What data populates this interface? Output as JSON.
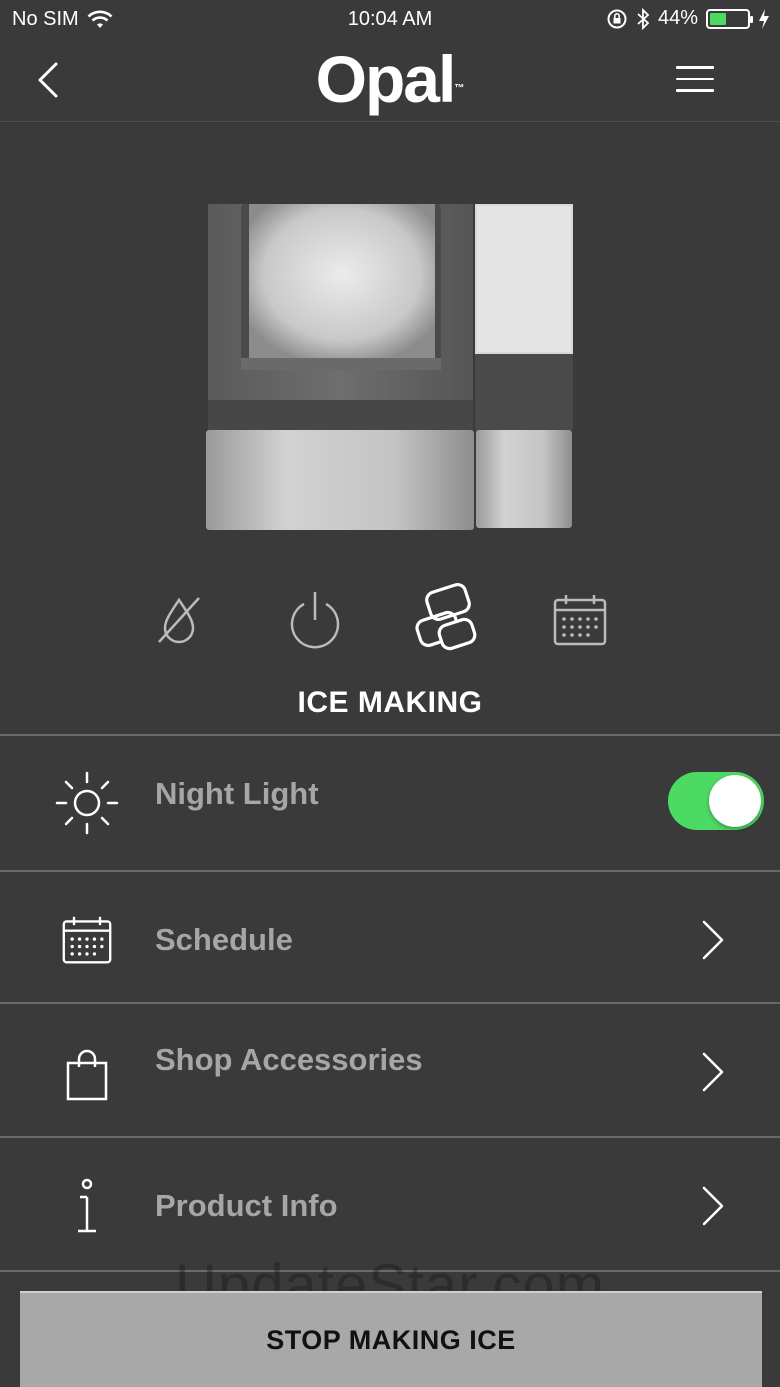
{
  "status_bar": {
    "carrier": "No SIM",
    "time": "10:04 AM",
    "battery": "44%",
    "battery_level": 0.44
  },
  "header": {
    "logo": "Opal",
    "logo_tm": "™"
  },
  "modes": {
    "icons": [
      "drain-icon",
      "power-icon",
      "ice-icon",
      "calendar-icon"
    ],
    "selected": "ICE MAKING"
  },
  "settings": {
    "night_light": {
      "label": "Night Light",
      "enabled": true
    },
    "schedule": {
      "label": "Schedule"
    },
    "shop": {
      "label": "Shop Accessories"
    },
    "product_info": {
      "label": "Product Info"
    }
  },
  "watermark": "UpdateStar.com",
  "action": {
    "stop_label": "STOP MAKING ICE"
  },
  "colors": {
    "background": "#3a3a3a",
    "toggle_on": "#4cd964",
    "button": "#a8a8a8"
  }
}
